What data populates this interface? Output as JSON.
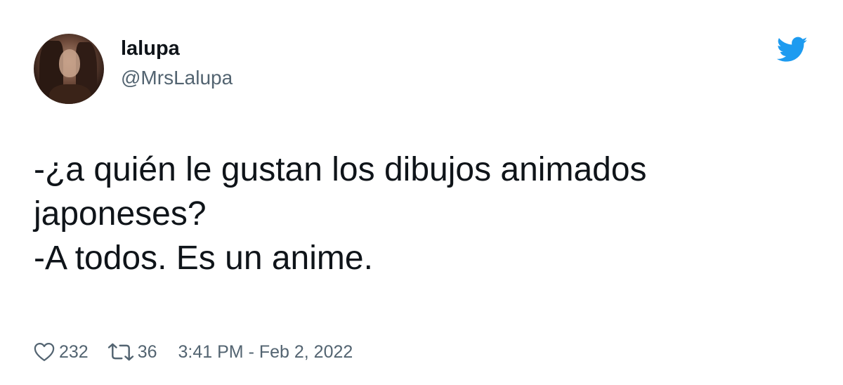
{
  "tweet": {
    "author": {
      "display_name": "lalupa",
      "handle": "@MrsLalupa",
      "avatar_icon": "profile-photo"
    },
    "text_lines": [
      "-¿a quién le gustan los dibujos animados",
      "japoneses?",
      "-A todos. Es un anime."
    ],
    "likes_count": "232",
    "retweets_count": "36",
    "timestamp": "3:41 PM - Feb 2, 2022",
    "icons": {
      "brand": "twitter-bird-icon",
      "likes": "heart-icon",
      "retweets": "retweet-icon"
    },
    "colors": {
      "brand_blue": "#1d9bf0",
      "primary_text": "#0f1419",
      "secondary_text": "#536471",
      "background": "#ffffff"
    }
  }
}
